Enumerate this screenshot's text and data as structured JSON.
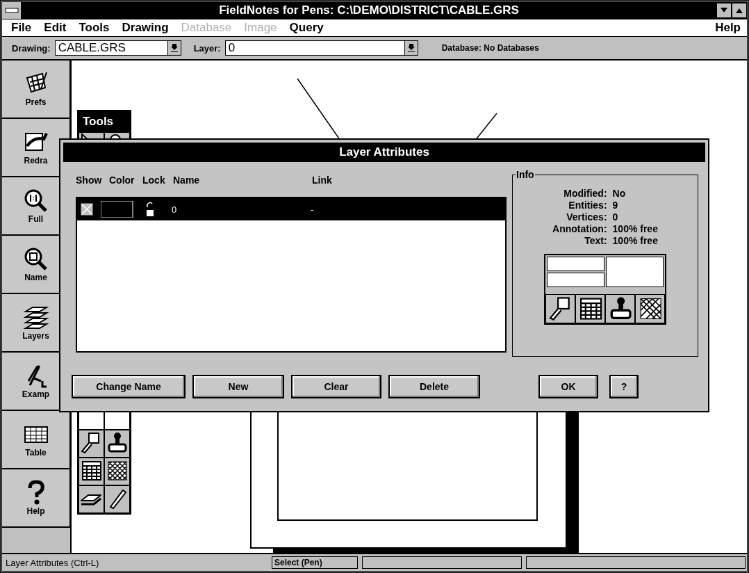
{
  "window": {
    "title": "FieldNotes for Pens: C:\\DEMO\\DISTRICT\\CABLE.GRS"
  },
  "menu": [
    {
      "label": "File",
      "disabled": false
    },
    {
      "label": "Edit",
      "disabled": false
    },
    {
      "label": "Tools",
      "disabled": false
    },
    {
      "label": "Drawing",
      "disabled": false
    },
    {
      "label": "Database",
      "disabled": true
    },
    {
      "label": "Image",
      "disabled": true
    },
    {
      "label": "Query",
      "disabled": false
    },
    {
      "label": "Help",
      "disabled": false
    }
  ],
  "toolbar": {
    "drawing_label": "Drawing:",
    "drawing_value": "CABLE.GRS",
    "layer_label": "Layer:",
    "layer_value": "0",
    "database": "Database: No Databases"
  },
  "sidebar": {
    "items": [
      {
        "label": "Prefs",
        "kind": "prefs"
      },
      {
        "label": "Redra",
        "kind": "redraw"
      },
      {
        "label": "Full",
        "kind": "full"
      },
      {
        "label": "Name",
        "kind": "named"
      },
      {
        "label": "Layers",
        "kind": "layers"
      },
      {
        "label": "Examp",
        "kind": "example"
      },
      {
        "label": "Table",
        "kind": "table"
      },
      {
        "label": "Help",
        "kind": "help"
      }
    ]
  },
  "tools_palette": {
    "title": "Tools"
  },
  "dialog": {
    "title": "Layer Attributes",
    "columns": [
      "Show",
      "Color",
      "Lock",
      "Name",
      "Link"
    ],
    "rows": [
      {
        "show": true,
        "locked": false,
        "name": "0",
        "link": "-",
        "selected": true
      }
    ],
    "info": {
      "title": "Info",
      "fields": [
        {
          "label": "Modified:",
          "value": "No"
        },
        {
          "label": "Entities:",
          "value": "9"
        },
        {
          "label": "Vertices:",
          "value": "0"
        },
        {
          "label": "Annotation:",
          "value": "100% free"
        },
        {
          "label": "Text:",
          "value": "100% free"
        }
      ]
    },
    "buttons": [
      "Change Name",
      "New",
      "Clear",
      "Delete"
    ],
    "ok": "OK",
    "help": "?"
  },
  "status_bar": {
    "message": "Layer Attributes (Ctrl-L)",
    "mode": "Select (Pen)"
  }
}
